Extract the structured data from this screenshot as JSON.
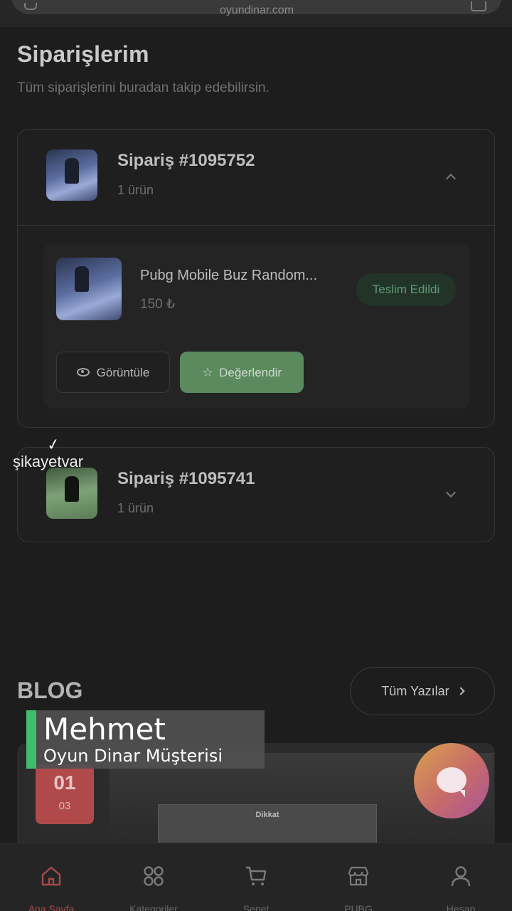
{
  "search": {
    "text": "oyundinar.com"
  },
  "header": {
    "title": "Siparişlerim",
    "subtitle": "Tüm siparişlerini buradan takip edebilirsin."
  },
  "orders": [
    {
      "number": "Sipariş #1095752",
      "count": "1 ürün",
      "expanded": true,
      "item": {
        "name": "Pubg Mobile Buz Random...",
        "price": "150 ₺",
        "status": "Teslim Edildi",
        "view_label": "Görüntüle",
        "rate_label": "Değerlendir"
      }
    },
    {
      "number": "Sipariş #1095741",
      "count": "1 ürün",
      "expanded": false
    }
  ],
  "watermark": {
    "text": "şikayetvar"
  },
  "blog": {
    "title": "BLOG",
    "all_posts_label": "Tüm Yazılar",
    "card": {
      "day": "01",
      "month": "03",
      "dialog_title": "Dikkat"
    }
  },
  "caption": {
    "name": "Mehmet",
    "role": "Oyun Dinar Müşterisi"
  },
  "nav": [
    {
      "label": "Ana Sayfa",
      "icon": "home-icon",
      "active": true
    },
    {
      "label": "Kategoriler",
      "icon": "grid-icon",
      "active": false
    },
    {
      "label": "Sepet",
      "icon": "cart-icon",
      "active": false
    },
    {
      "label": "PUBG",
      "icon": "store-icon",
      "active": false
    },
    {
      "label": "Hesap",
      "icon": "user-icon",
      "active": false
    }
  ],
  "colors": {
    "background": "#1d1d1d",
    "status_green": "#5e9a74",
    "accent_green": "#5a8a5e",
    "active_nav": "#a64a4a",
    "caption_bar": "#3fbf6e"
  }
}
